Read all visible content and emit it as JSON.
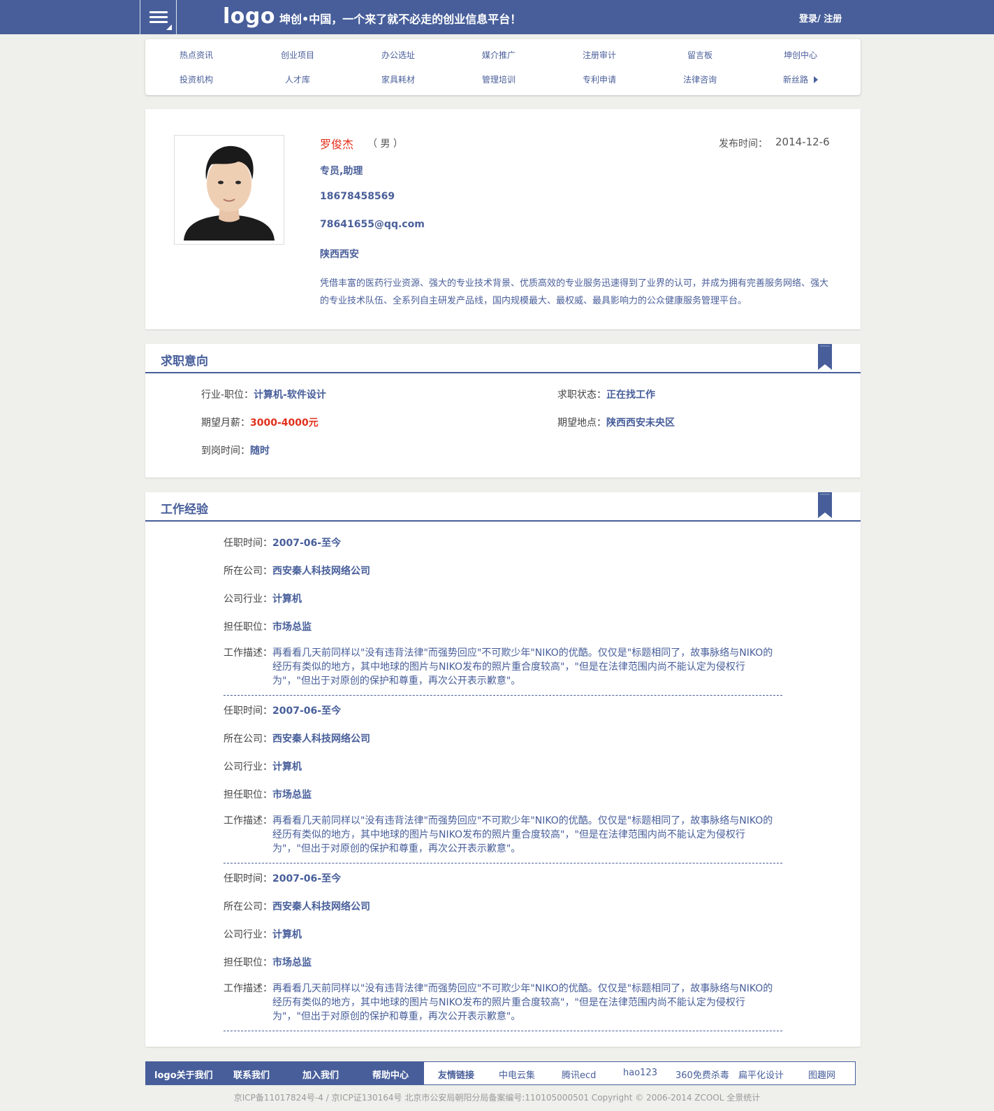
{
  "header": {
    "logo": "logo",
    "slogan": "坤创•中国，一个来了就不必走的创业信息平台！",
    "auth": "登录/ 注册"
  },
  "nav": {
    "row1": [
      "热点资讯",
      "创业项目",
      "办公选址",
      "媒介推广",
      "注册审计",
      "留言板",
      "坤创中心"
    ],
    "row2": [
      "投资机构",
      "人才库",
      "家具耗材",
      "管理培训",
      "专利申请",
      "法律咨询",
      "新丝路"
    ]
  },
  "profile": {
    "name": "罗俊杰",
    "gender": "（ 男 ）",
    "publish_label": "发布时间：",
    "publish_date": "2014-12-6",
    "position": "专员,助理",
    "phone": "18678458569",
    "email": "78641655@qq.com",
    "location": "陕西西安",
    "description": "凭借丰富的医药行业资源、强大的专业技术背景、优质高效的专业服务迅速得到了业界的认可，并成为拥有完善服务网络、强大的专业技术队伍、全系列自主研发产品线，国内规模最大、最权威、最具影响力的公众健康服务管理平台。"
  },
  "intent": {
    "title": "求职意向",
    "industry_label": "行业-职位：",
    "industry_value": "计算机-软件设计",
    "status_label": "求职状态：",
    "status_value": "正在找工作",
    "salary_label": "期望月薪：",
    "salary_value": "3000-4000元",
    "place_label": "期望地点：",
    "place_value": "陕西西安未央区",
    "arrival_label": "到岗时间：",
    "arrival_value": "随时"
  },
  "work": {
    "title": "工作经验",
    "labels": {
      "time": "任职时间：",
      "company": "所在公司：",
      "industry": "公司行业：",
      "position": "担任职位：",
      "desc": "工作描述："
    },
    "items": [
      {
        "time": "2007-06-至今",
        "company": "西安秦人科技网络公司",
        "industry": "计算机",
        "position": "市场总监",
        "desc": "再看看几天前同样以\"没有违背法律\"而强势回应\"不可欺少年\"NIKO的优酷。仅仅是\"标题相同了，故事脉络与NIKO的经历有类似的地方，其中地球的图片与NIKO发布的照片重合度较高\"，\"但是在法律范围内尚不能认定为侵权行为\"，\"但出于对原创的保护和尊重，再次公开表示歉意\"。"
      },
      {
        "time": "2007-06-至今",
        "company": "西安秦人科技网络公司",
        "industry": "计算机",
        "position": "市场总监",
        "desc": "再看看几天前同样以\"没有违背法律\"而强势回应\"不可欺少年\"NIKO的优酷。仅仅是\"标题相同了，故事脉络与NIKO的经历有类似的地方，其中地球的图片与NIKO发布的照片重合度较高\"，\"但是在法律范围内尚不能认定为侵权行为\"，\"但出于对原创的保护和尊重，再次公开表示歉意\"。"
      },
      {
        "time": "2007-06-至今",
        "company": "西安秦人科技网络公司",
        "industry": "计算机",
        "position": "市场总监",
        "desc": "再看看几天前同样以\"没有违背法律\"而强势回应\"不可欺少年\"NIKO的优酷。仅仅是\"标题相同了，故事脉络与NIKO的经历有类似的地方，其中地球的图片与NIKO发布的照片重合度较高\"，\"但是在法律范围内尚不能认定为侵权行为\"，\"但出于对原创的保护和尊重，再次公开表示歉意\"。"
      }
    ]
  },
  "footer": {
    "left_links": [
      "logo关于我们",
      "联系我们",
      "加入我们",
      "帮助中心"
    ],
    "friend_label": "友情链接",
    "right_links": [
      "中电云集",
      "腾讯ecd",
      "hao123",
      "360免费杀毒",
      "扁平化设计",
      "图趣网"
    ],
    "copyright": "京ICP备11017824号-4 / 京ICP证130164号 北京市公安局朝阳分局备案编号:110105000501 Copyright © 2006-2014 ZCOOL 全景统计"
  },
  "colors": {
    "brand": "#475e9a",
    "accent_red": "#e2301c",
    "background": "#efefeb"
  }
}
